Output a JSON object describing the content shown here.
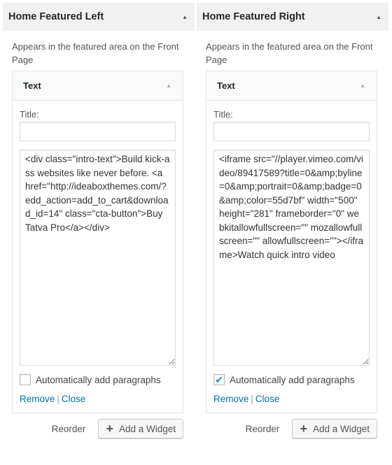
{
  "sidebars": [
    {
      "title": "Home Featured Left",
      "description": "Appears in the featured area on the Front Page",
      "collapse_icon": "arrow-up-icon",
      "widget": {
        "title": "Text",
        "title_label": "Title:",
        "title_value": "",
        "content": "<div class=\"intro-text\">Build kick-ass websites like never before. <a href=\"http://ideaboxthemes.com/?edd_action=add_to_cart&download_id=14\" class=\"cta-button\">Buy Tatva Pro</a></div>",
        "auto_paragraphs_label": "Automatically add paragraphs",
        "auto_paragraphs_checked": false,
        "remove_label": "Remove",
        "separator": "|",
        "close_label": "Close"
      },
      "reorder_label": "Reorder",
      "add_widget_label": "Add a Widget"
    },
    {
      "title": "Home Featured Right",
      "description": "Appears in the featured area on the Front Page",
      "collapse_icon": "arrow-up-icon",
      "widget": {
        "title": "Text",
        "title_label": "Title:",
        "title_value": "",
        "content": "<iframe src=\"//player.vimeo.com/video/89417589?title=0&amp;byline=0&amp;portrait=0&amp;badge=0&amp;color=55d7bf\" width=\"500\" height=\"281\" frameborder=\"0\" webkitallowfullscreen=\"\" mozallowfullscreen=\"\" allowfullscreen=\"\"></iframe>Watch quick intro video",
        "auto_paragraphs_label": "Automatically add paragraphs",
        "auto_paragraphs_checked": true,
        "remove_label": "Remove",
        "separator": "|",
        "close_label": "Close"
      },
      "reorder_label": "Reorder",
      "add_widget_label": "Add a Widget"
    }
  ],
  "icons": {
    "arrow": "▲",
    "check": "✔",
    "plus": "+"
  },
  "colors": {
    "link": "#0073aa",
    "check": "#1e8cbe",
    "header_bg": "#f1f1f1"
  }
}
